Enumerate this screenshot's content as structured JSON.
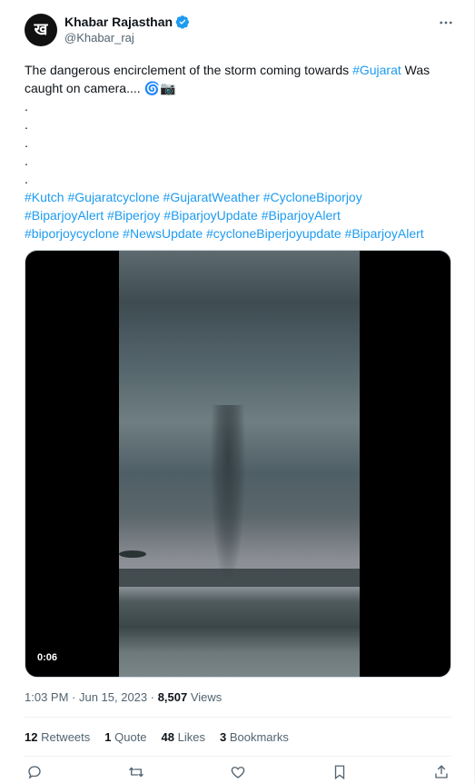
{
  "author": {
    "display_name": "Khabar Rajasthan",
    "handle": "@Khabar_raj",
    "avatar_glyph": "ख",
    "verified": true
  },
  "tweet": {
    "line1_plain": "The dangerous encirclement of the storm coming towards ",
    "line1_hashtag": "#Gujarat",
    "line1_rest": " Was caught on camera.... 🌀📷",
    "dots": [
      ".",
      ".",
      ".",
      ".",
      "."
    ],
    "hashtags_line1": "#Kutch #Gujaratcyclone #GujaratWeather #CycloneBiporjoy",
    "hashtags_line2": "#BiparjoyAlert #Biperjoy #BiparjoyUpdate #BiparjoyAlert",
    "hashtags_line3": "#biporjoycyclone #NewsUpdate #cycloneBiperjoyupdate #BiparjoyAlert"
  },
  "media": {
    "duration": "0:06"
  },
  "meta": {
    "time": "1:03 PM · Jun 15, 2023 · ",
    "views_count": "8,507",
    "views_label": " Views"
  },
  "stats": {
    "retweets_count": "12",
    "retweets_label": " Retweets",
    "quotes_count": "1",
    "quotes_label": " Quote",
    "likes_count": "48",
    "likes_label": " Likes",
    "bookmarks_count": "3",
    "bookmarks_label": " Bookmarks"
  },
  "colors": {
    "link": "#1d9bf0",
    "secondary_text": "#536471",
    "verified": "#1d9bf0"
  }
}
